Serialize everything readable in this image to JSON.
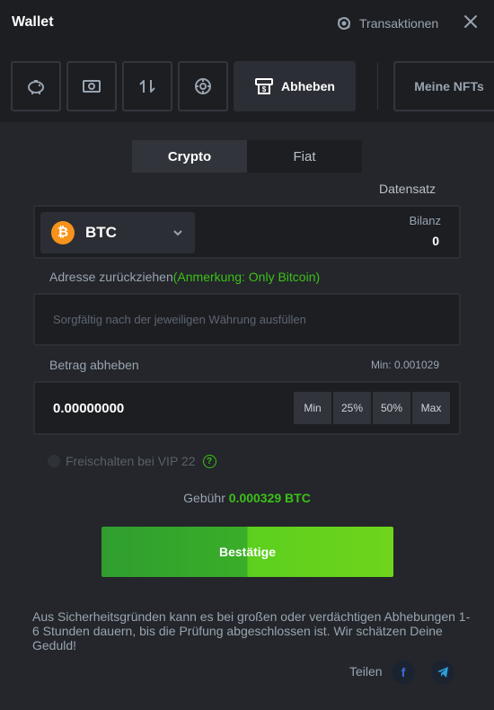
{
  "header": {
    "title": "Wallet",
    "transactions_label": "Transaktionen"
  },
  "tabs": [
    {
      "icon": "piggy-bank-icon"
    },
    {
      "icon": "banknote-icon"
    },
    {
      "icon": "swap-icon"
    },
    {
      "icon": "vault-icon"
    },
    {
      "icon": "withdraw-icon",
      "label": "Abheben",
      "active": true
    },
    {
      "label": "Meine NFTs"
    }
  ],
  "switch": {
    "crypto": "Crypto",
    "fiat": "Fiat",
    "selected": "Crypto"
  },
  "datensatz_label": "Datensatz",
  "coin": {
    "symbol": "BTC",
    "icon_letter": "₿",
    "balance_label": "Bilanz",
    "balance_value": "0"
  },
  "address": {
    "label": "Adresse zurückziehen",
    "note": "(Anmerkung: Only Bitcoin)",
    "placeholder": "Sorgfältig nach der jeweiligen Währung ausfüllen"
  },
  "amount": {
    "label": "Betrag abheben",
    "min_label": "Min: 0.001029",
    "value": "0.00000000",
    "quick": [
      "Min",
      "25%",
      "50%",
      "Max"
    ]
  },
  "vip_unlock": {
    "label": "Freischalten bei VIP 22",
    "help": "?"
  },
  "fee": {
    "label": "Gebühr",
    "value": "0.000329 BTC"
  },
  "confirm_label": "Bestätige",
  "notice": "Aus Sicherheitsgründen kann es bei großen oder verdächtigen Abhebungen 1-6 Stunden dauern, bis die Prüfung abgeschlossen ist. Wir schätzen Deine Geduld!",
  "share": {
    "label": "Teilen",
    "facebook": "f",
    "telegram_icon": "telegram-icon"
  },
  "colors": {
    "accent_green": "#3bc117",
    "btc_orange": "#f7931a"
  }
}
